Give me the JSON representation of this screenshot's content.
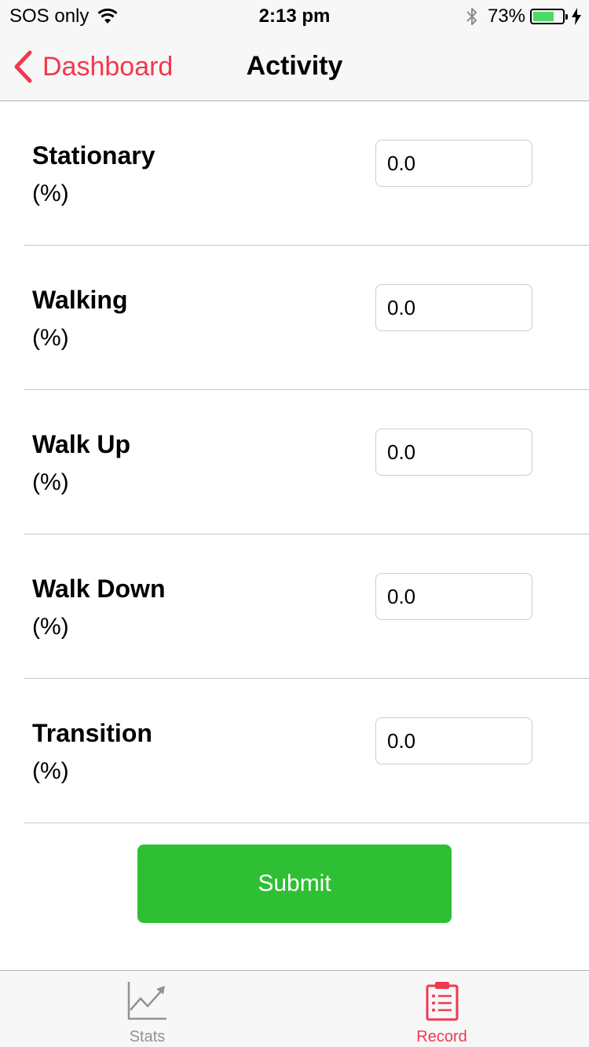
{
  "status_bar": {
    "carrier": "SOS only",
    "time": "2:13 pm",
    "battery_percent": "73%",
    "battery_level": 0.73,
    "icons": [
      "wifi-icon",
      "bluetooth-icon",
      "battery-icon",
      "charging-icon"
    ]
  },
  "nav": {
    "back_label": "Dashboard",
    "title": "Activity",
    "accent_color": "#f0394f"
  },
  "form": {
    "rows": [
      {
        "label": "Stationary",
        "unit": "(%)",
        "value": "0.0"
      },
      {
        "label": "Walking",
        "unit": "(%)",
        "value": "0.0"
      },
      {
        "label": "Walk Up",
        "unit": "(%)",
        "value": "0.0"
      },
      {
        "label": "Walk Down",
        "unit": "(%)",
        "value": "0.0"
      },
      {
        "label": "Transition",
        "unit": "(%)",
        "value": "0.0"
      }
    ],
    "submit_label": "Submit",
    "submit_color": "#2fbf34"
  },
  "tab_bar": {
    "tabs": [
      {
        "label": "Stats",
        "icon": "line-chart-icon",
        "selected": false
      },
      {
        "label": "Record",
        "icon": "clipboard-icon",
        "selected": true
      }
    ],
    "selected_color": "#f0394f",
    "unselected_color": "#929292"
  }
}
